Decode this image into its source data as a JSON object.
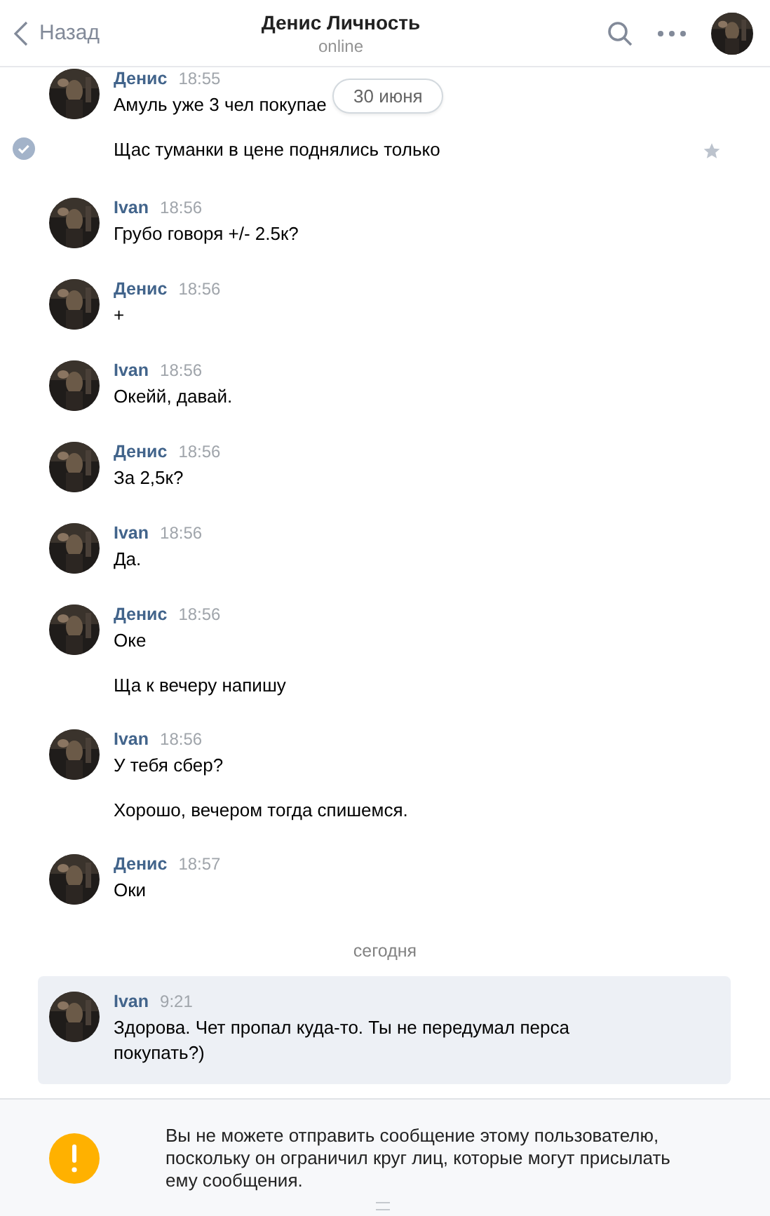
{
  "header": {
    "back_label": "Назад",
    "title": "Денис Личность",
    "status": "online"
  },
  "date_pill": "30 июня",
  "groups": [
    {
      "author": "Денис",
      "time": "18:55",
      "unread": false,
      "messages": [
        {
          "text": "Амуль уже 3 чел покупае",
          "selected": false
        },
        {
          "text": "Щас туманки в цене поднялись только",
          "selected": true
        }
      ]
    },
    {
      "author": "Ivan",
      "time": "18:56",
      "unread": false,
      "messages": [
        {
          "text": "Грубо говоря +/- 2.5к?",
          "selected": false
        }
      ]
    },
    {
      "author": "Денис",
      "time": "18:56",
      "unread": false,
      "messages": [
        {
          "text": "+",
          "selected": false
        }
      ]
    },
    {
      "author": "Ivan",
      "time": "18:56",
      "unread": false,
      "messages": [
        {
          "text": "Окейй, давай.",
          "selected": false
        }
      ]
    },
    {
      "author": "Денис",
      "time": "18:56",
      "unread": false,
      "messages": [
        {
          "text": "За 2,5к?",
          "selected": false
        }
      ]
    },
    {
      "author": "Ivan",
      "time": "18:56",
      "unread": false,
      "messages": [
        {
          "text": "Да.",
          "selected": false
        }
      ]
    },
    {
      "author": "Денис",
      "time": "18:56",
      "unread": false,
      "messages": [
        {
          "text": "Оке",
          "selected": false
        },
        {
          "text": "Ща к вечеру напишу",
          "selected": false
        }
      ]
    },
    {
      "author": "Ivan",
      "time": "18:56",
      "unread": false,
      "messages": [
        {
          "text": "У тебя сбер?",
          "selected": false
        },
        {
          "text": "Хорошо, вечером тогда спишемся.",
          "selected": false
        }
      ]
    },
    {
      "author": "Денис",
      "time": "18:57",
      "unread": false,
      "messages": [
        {
          "text": "Оки",
          "selected": false
        }
      ]
    },
    {
      "kind": "divider",
      "label": "сегодня"
    },
    {
      "author": "Ivan",
      "time": "9:21",
      "unread": true,
      "messages": [
        {
          "text": "Здорова. Чет пропал куда-то. Ты не передумал перса покупать?)",
          "selected": false
        }
      ]
    }
  ],
  "notice": "Вы не можете отправить сообщение этому пользователю, поскольку он ограничил круг лиц, которые могут присылать ему сообщения."
}
